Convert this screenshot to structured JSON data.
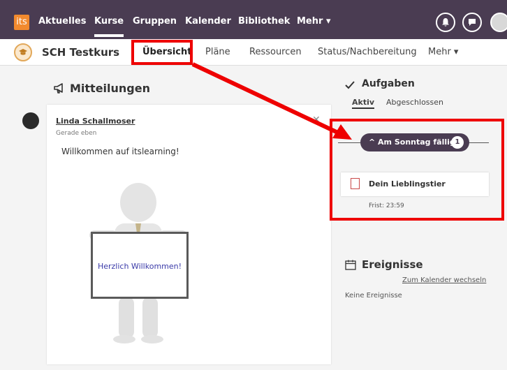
{
  "topnav": {
    "logo": "its",
    "items": [
      "Aktuelles",
      "Kurse",
      "Gruppen",
      "Kalender",
      "Bibliothek",
      "Mehr ▾"
    ]
  },
  "course": {
    "title": "SCH Testkurs",
    "tabs": [
      "Übersicht",
      "Pläne",
      "Ressourcen",
      "Status/Nachbereitung",
      "Mehr ▾"
    ]
  },
  "announcements": {
    "title": "Mitteilungen",
    "post": {
      "author": "Linda Schallmoser",
      "time": "Gerade eben",
      "text": "Willkommen auf itslearning!",
      "image_text": "Herzlich Willkommen!"
    }
  },
  "tasks": {
    "title": "Aufgaben",
    "tabs": [
      "Aktiv",
      "Abgeschlossen"
    ],
    "group_label": "Am Sonntag fällig",
    "group_count": "1",
    "items": [
      {
        "title": "Dein Lieblingstier",
        "due": "Frist: 23:59"
      }
    ]
  },
  "events": {
    "title": "Ereignisse",
    "calendar_link": "Zum Kalender wechseln",
    "empty": "Keine Ereignisse"
  },
  "colors": {
    "nav_bg": "#4a3c52",
    "highlight": "#ee0000",
    "logo": "#f28a2e"
  }
}
